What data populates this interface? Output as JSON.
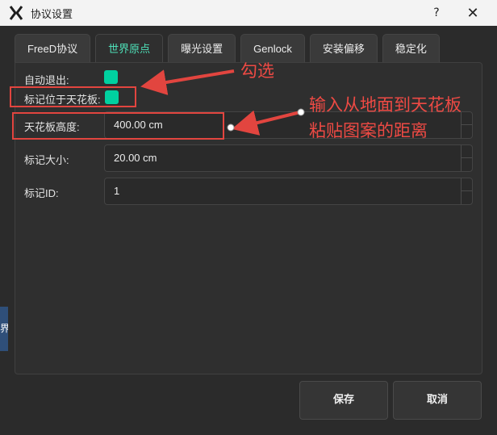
{
  "window": {
    "title": "协议设置",
    "help_label": "?",
    "close_label": "✕",
    "app_icon": "x-logo-icon"
  },
  "background_stub": {
    "text": "界"
  },
  "tabs": [
    {
      "label": "FreeD协议",
      "active": false
    },
    {
      "label": "世界原点",
      "active": true
    },
    {
      "label": "曝光设置",
      "active": false
    },
    {
      "label": "Genlock",
      "active": false
    },
    {
      "label": "安装偏移",
      "active": false
    },
    {
      "label": "稳定化",
      "active": false
    }
  ],
  "form": {
    "auto_exit_label": "自动退出:",
    "auto_exit_checked": true,
    "marker_ceiling_label": "标记位于天花板:",
    "marker_ceiling_checked": true,
    "ceiling_height_label": "天花板高度:",
    "ceiling_height_value": "400.00 cm",
    "marker_size_label": "标记大小:",
    "marker_size_value": "20.00 cm",
    "marker_id_label": "标记ID:",
    "marker_id_value": "1"
  },
  "buttons": {
    "save_label": "保存",
    "cancel_label": "取消"
  },
  "annotations": {
    "check_note": "勾选",
    "height_note_line1": "输入从地面到天花板",
    "height_note_line2": "粘贴图案的距离",
    "color": "#e2453f"
  },
  "colors": {
    "accent": "#00d1a0",
    "active_tab_text": "#4ee0b8",
    "background": "#2b2b2b"
  }
}
